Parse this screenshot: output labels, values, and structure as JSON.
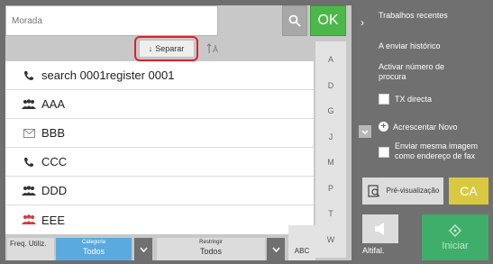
{
  "address": {
    "placeholder": "Morada"
  },
  "ok_label": "OK",
  "sort_label": "Separar",
  "contacts": [
    {
      "name": "search 0001register 0001",
      "icon": "phone-icon"
    },
    {
      "name": "AAA",
      "icon": "group-icon"
    },
    {
      "name": "BBB",
      "icon": "email-icon"
    },
    {
      "name": "CCC",
      "icon": "phone-icon"
    },
    {
      "name": "DDD",
      "icon": "group-icon"
    },
    {
      "name": "EEE",
      "icon": "group-red-icon"
    }
  ],
  "index_letters": [
    "A",
    "D",
    "G",
    "J",
    "M",
    "P",
    "T",
    "W"
  ],
  "tabs": {
    "freq": "Freq. Utiliz.",
    "category_label": "Categoria",
    "category_value": "Todos",
    "restrict_label": "Restringir",
    "restrict_value": "Todos",
    "abc": "ABC"
  },
  "right_menu": {
    "recent_jobs": "Trabalhos recentes",
    "send_history": "A enviar histórico",
    "activate_search": "Activar número de procura",
    "tx_direct": "TX directa",
    "add_new": "Acrescentar Novo",
    "send_same_image": "Enviar mesma imagem como endereço de fax"
  },
  "preview_label": "Pré-visualização",
  "ca_label": "CA",
  "volume_label": "Altifal.",
  "start_label": "Iniciar",
  "colors": {
    "ok": "#4db84a",
    "ca": "#d9c940",
    "start": "#3fae6a",
    "category_tab": "#5aaadf",
    "sort_highlight": "#e0202a"
  }
}
